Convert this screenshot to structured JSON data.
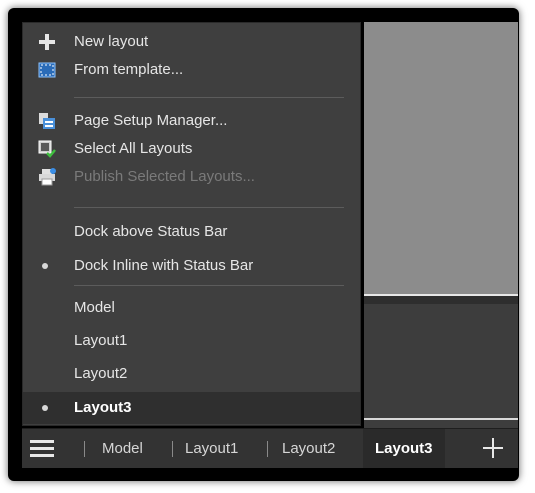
{
  "menu": {
    "items": [
      {
        "label": "New layout",
        "icon": "plus-icon"
      },
      {
        "label": "From template...",
        "icon": "template-icon"
      },
      {
        "label": "Page Setup Manager...",
        "icon": "page-setup-icon"
      },
      {
        "label": "Select All Layouts",
        "icon": "select-layouts-icon"
      },
      {
        "label": "Publish Selected Layouts...",
        "icon": "publish-icon",
        "disabled": true
      },
      {
        "label": "Dock above Status Bar"
      },
      {
        "label": "Dock Inline with Status Bar",
        "checked": true
      },
      {
        "label": "Model"
      },
      {
        "label": "Layout1"
      },
      {
        "label": "Layout2"
      },
      {
        "label": "Layout3",
        "checked": true,
        "selected": true
      }
    ]
  },
  "tabbar": {
    "menu_icon": "hamburger-icon",
    "tabs": [
      "Model",
      "Layout1",
      "Layout2",
      "Layout3"
    ],
    "active_tab": "Layout3",
    "add_icon": "plus-icon"
  },
  "colors": {
    "menu_bg": "#3f3f3f",
    "tabbar_bg": "#333333",
    "canvas": "#8c8c8c",
    "text": "#e6e6e6",
    "disabled_text": "#7a7a7a"
  }
}
